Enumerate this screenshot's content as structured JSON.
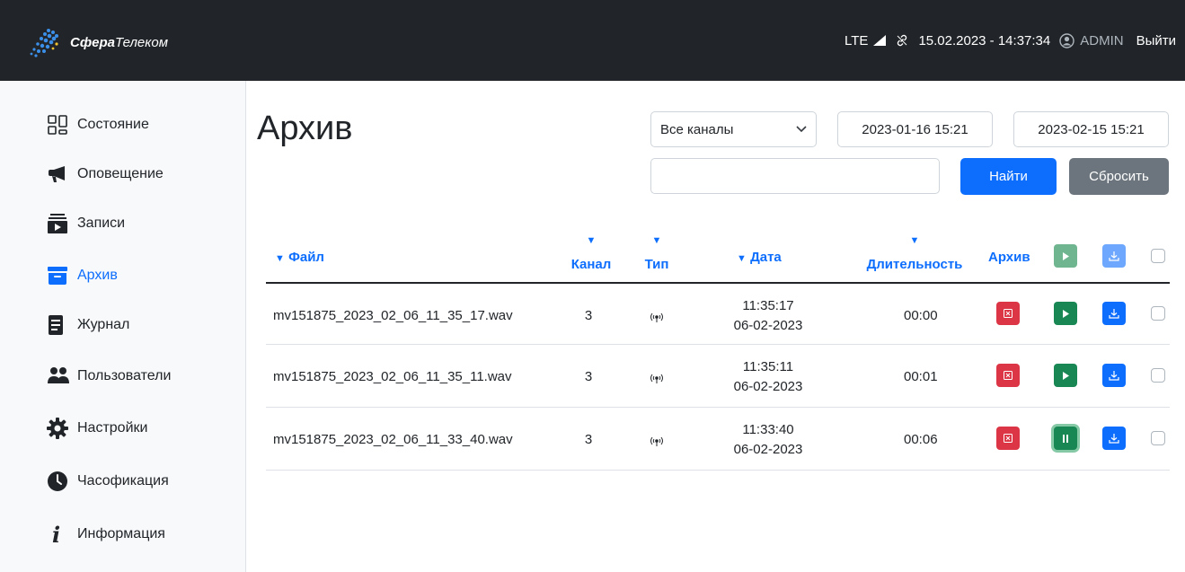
{
  "brand": {
    "name_bold": "Сфера",
    "name_rest": "Телеком"
  },
  "status": {
    "network": "LTE",
    "datetime": "15.02.2023 - 14:37:34",
    "user": "ADMIN",
    "logout": "Выйти"
  },
  "sidebar": {
    "items": [
      {
        "label": "Состояние",
        "icon": "grid-icon"
      },
      {
        "label": "Оповещение",
        "icon": "megaphone-icon"
      },
      {
        "label": "Записи",
        "icon": "playlist-icon"
      },
      {
        "label": "Архив",
        "icon": "archive-icon",
        "active": true
      },
      {
        "label": "Журнал",
        "icon": "journal-icon"
      },
      {
        "label": "Пользователи",
        "icon": "users-icon"
      },
      {
        "label": "Настройки",
        "icon": "gear-icon"
      },
      {
        "label": "Часофикация",
        "icon": "clock-icon"
      },
      {
        "label": "Информация",
        "icon": "info-icon"
      }
    ]
  },
  "page": {
    "title": "Архив",
    "channel_select": "Все каналы",
    "date_from": "2023-01-16 15:21",
    "date_to": "2023-02-15 15:21",
    "search_value": "",
    "find_label": "Найти",
    "reset_label": "Сбросить"
  },
  "table": {
    "headers": {
      "file": "Файл",
      "channel": "Канал",
      "type": "Тип",
      "date": "Дата",
      "duration": "Длительность",
      "archive": "Архив"
    },
    "rows": [
      {
        "file": "mv151875_2023_02_06_11_35_17.wav",
        "channel": "3",
        "time": "11:35:17",
        "date": "06-02-2023",
        "duration": "00:00",
        "state": "play"
      },
      {
        "file": "mv151875_2023_02_06_11_35_11.wav",
        "channel": "3",
        "time": "11:35:11",
        "date": "06-02-2023",
        "duration": "00:01",
        "state": "play"
      },
      {
        "file": "mv151875_2023_02_06_11_33_40.wav",
        "channel": "3",
        "time": "11:33:40",
        "date": "06-02-2023",
        "duration": "00:06",
        "state": "pause"
      }
    ]
  },
  "colors": {
    "primary": "#0d6efd",
    "danger": "#dc3545",
    "success": "#198754",
    "secondary": "#6c757d",
    "topbar": "#212529"
  }
}
